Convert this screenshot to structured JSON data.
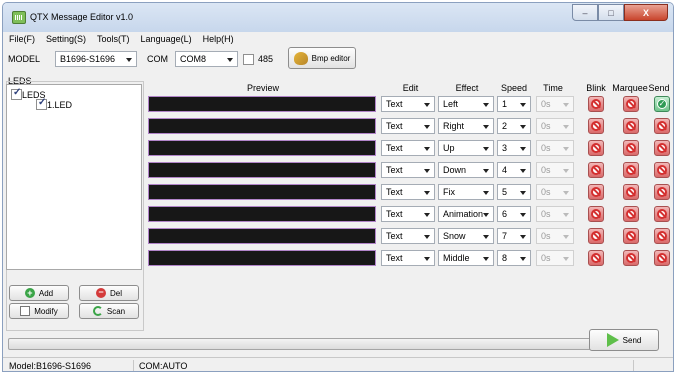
{
  "window": {
    "title": "QTX Message Editor v1.0",
    "minimize": "–",
    "maximize": "□",
    "close": "X"
  },
  "menu": [
    "File(F)",
    "Setting(S)",
    "Tools(T)",
    "Language(L)",
    "Help(H)"
  ],
  "toolbar": {
    "model_label": "MODEL",
    "model_value": "B1696-S1696",
    "com_label": "COM",
    "com_value": "COM8",
    "rs485_label": "485",
    "rs485_checked": false,
    "bmp_button": "Bmp editor"
  },
  "leds": {
    "group_label": "LEDS",
    "tree": [
      {
        "label": "LEDS",
        "checked": true
      },
      {
        "label": "1.LED",
        "checked": true
      }
    ],
    "buttons": {
      "add": "Add",
      "del": "Del",
      "modify": "Modify",
      "scan": "Scan"
    }
  },
  "columns": {
    "preview": "Preview",
    "edit": "Edit",
    "effect": "Effect",
    "speed": "Speed",
    "time": "Time",
    "blink": "Blink",
    "marquee": "Marquee",
    "send": "Send"
  },
  "rows": [
    {
      "edit": "Text",
      "effect": "Left",
      "speed": "1",
      "time": "0s",
      "blink": "off",
      "marquee": "off",
      "send": "on"
    },
    {
      "edit": "Text",
      "effect": "Right",
      "speed": "2",
      "time": "0s",
      "blink": "off",
      "marquee": "off",
      "send": "off"
    },
    {
      "edit": "Text",
      "effect": "Up",
      "speed": "3",
      "time": "0s",
      "blink": "off",
      "marquee": "off",
      "send": "off"
    },
    {
      "edit": "Text",
      "effect": "Down",
      "speed": "4",
      "time": "0s",
      "blink": "off",
      "marquee": "off",
      "send": "off"
    },
    {
      "edit": "Text",
      "effect": "Fix",
      "speed": "5",
      "time": "0s",
      "blink": "off",
      "marquee": "off",
      "send": "off"
    },
    {
      "edit": "Text",
      "effect": "Animation",
      "speed": "6",
      "time": "0s",
      "blink": "off",
      "marquee": "off",
      "send": "off"
    },
    {
      "edit": "Text",
      "effect": "Snow",
      "speed": "7",
      "time": "0s",
      "blink": "off",
      "marquee": "off",
      "send": "off"
    },
    {
      "edit": "Text",
      "effect": "Middle",
      "speed": "8",
      "time": "0s",
      "blink": "off",
      "marquee": "off",
      "send": "off"
    }
  ],
  "send_button": "Send",
  "progress": 0,
  "status": {
    "model": "Model:B1696-S1696",
    "com": "COM:AUTO"
  }
}
